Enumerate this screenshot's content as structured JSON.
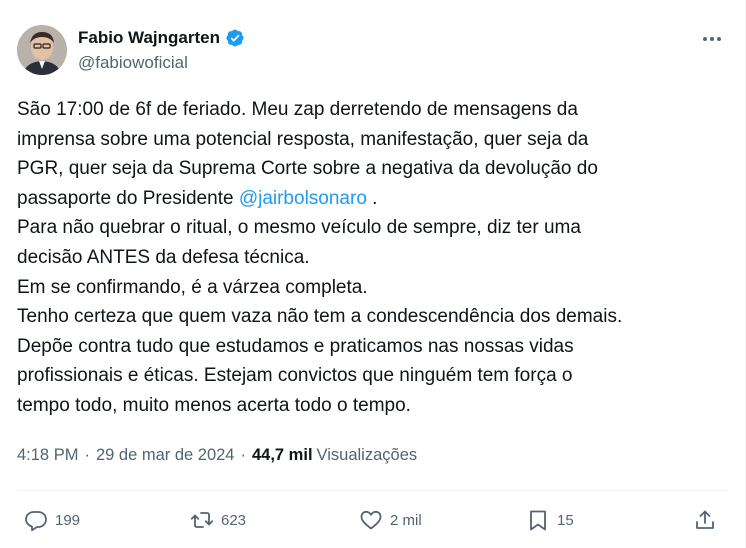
{
  "author": {
    "display_name": "Fabio Wajngarten",
    "handle": "@fabiowoficial",
    "verified_icon": "verified-badge-icon"
  },
  "tweet": {
    "lines": [
      [
        "São 17:00 de 6f de feriado. Meu zap derretendo de mensagens da"
      ],
      [
        "imprensa sobre uma potencial resposta, manifestação, quer seja da"
      ],
      [
        "PGR, quer seja da Suprema Corte sobre a negativa da devolução do"
      ],
      [
        "passaporte do Presidente ",
        "@jairbolsonaro",
        " ."
      ],
      [
        "Para não quebrar o ritual, o mesmo veículo de sempre, diz ter uma"
      ],
      [
        "decisão ANTES da defesa técnica."
      ],
      [
        "Em se confirmando, é a várzea completa."
      ],
      [
        "Tenho certeza que quem vaza não tem a condescendência dos demais."
      ],
      [
        "Depõe contra tudo que estudamos e praticamos nas nossas vidas"
      ],
      [
        "profissionais e éticas. Estejam convictos que ninguém tem força o"
      ],
      [
        "tempo todo, muito menos acerta todo o tempo."
      ]
    ]
  },
  "meta": {
    "time": "4:18 PM",
    "dot1": "·",
    "date": "29 de mar de 2024",
    "dot2": "·",
    "views_count": "44,7 mil",
    "views_label": "Visualizações"
  },
  "actions": {
    "replies": "199",
    "reposts": "623",
    "likes": "2 mil",
    "bookmarks": "15"
  },
  "colors": {
    "accent": "#1d9bf0",
    "secondary_text": "#536471",
    "primary_text": "#0f1419"
  }
}
